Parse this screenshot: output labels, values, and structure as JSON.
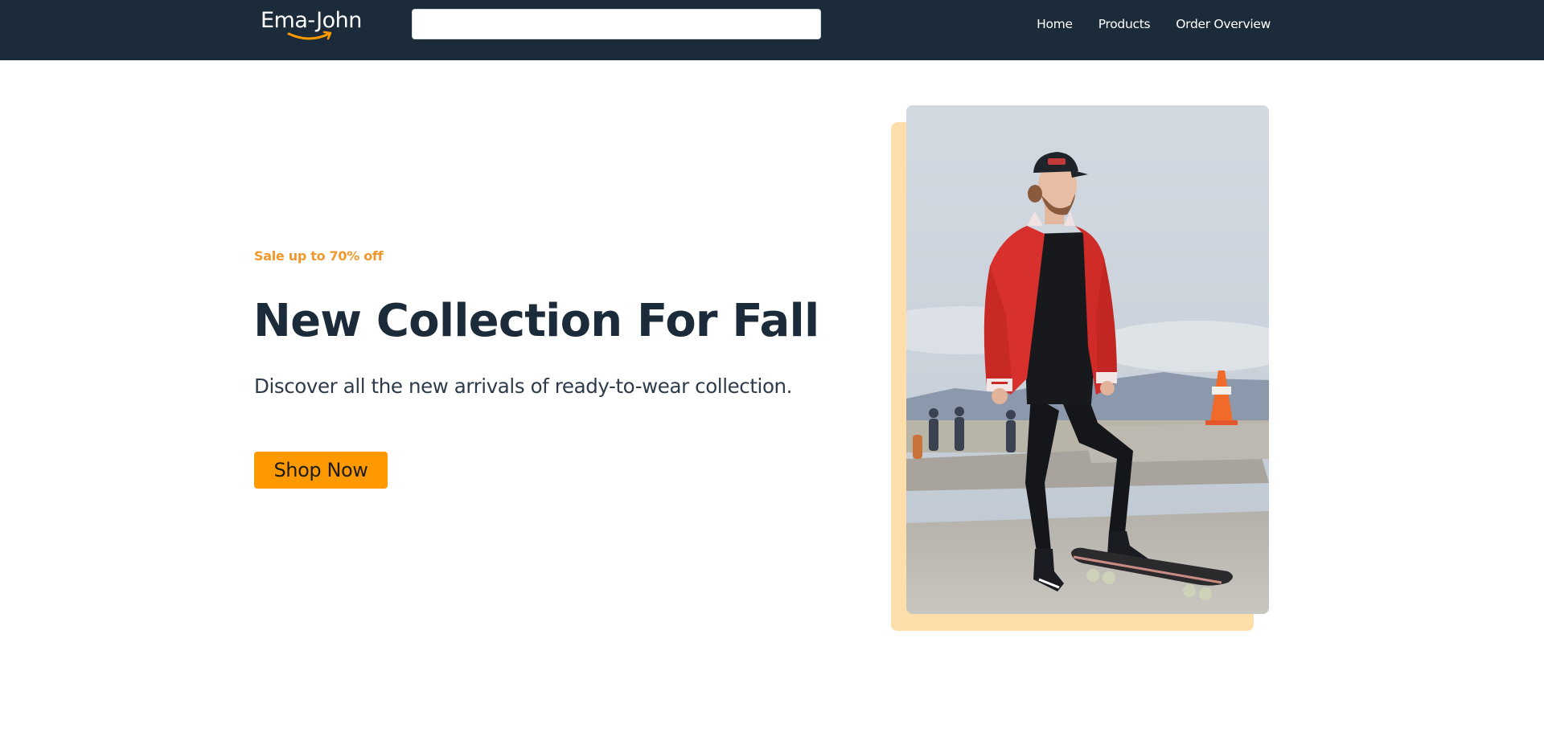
{
  "header": {
    "logo_text": "Ema-John",
    "search": {
      "value": "",
      "placeholder": ""
    },
    "nav": [
      {
        "label": "Home"
      },
      {
        "label": "Products"
      },
      {
        "label": "Order Overview"
      }
    ]
  },
  "hero": {
    "sale_text": "Sale up to 70% off",
    "title": "New Collection For Fall",
    "subtitle": "Discover all the new arrivals of ready-to-wear collection.",
    "cta_label": "Shop Now"
  },
  "colors": {
    "header_bg": "#1c2b39",
    "accent": "#ff9900",
    "sale_text": "#f2982c",
    "title": "#1c2b39",
    "image_backdrop": "#fedfac"
  },
  "icons": {
    "logo_smile": "amazon-smile-arrow"
  }
}
